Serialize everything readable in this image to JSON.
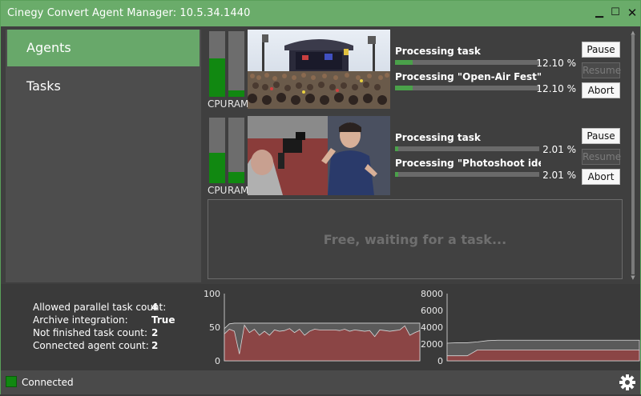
{
  "window": {
    "title": "Cinegy Convert Agent Manager: 10.5.34.1440",
    "controls": {
      "minimize": "▁",
      "maximize": "☐",
      "close": "✕"
    }
  },
  "sidebar": {
    "items": [
      {
        "label": "Agents",
        "active": true
      },
      {
        "label": "Tasks",
        "active": false
      }
    ]
  },
  "agents": [
    {
      "cpu_level": 0.58,
      "ram_level": 0.1,
      "cpu_label": "CPU",
      "ram_label": "RAM",
      "thumbnail": "concert-crowd",
      "tasks": [
        {
          "title": "Processing task",
          "percent_text": "12.10 %",
          "progress": 0.121
        },
        {
          "title": "Processing \"Open-Air Fest\" sour",
          "percent_text": "12.10 %",
          "progress": 0.121
        }
      ],
      "buttons": {
        "pause": "Pause",
        "resume": "Resume",
        "abort": "Abort"
      }
    },
    {
      "cpu_level": 0.46,
      "ram_level": 0.17,
      "cpu_label": "CPU",
      "ram_label": "RAM",
      "thumbnail": "camera-operator-interview",
      "tasks": [
        {
          "title": "Processing task",
          "percent_text": "2.01 %",
          "progress": 0.0201
        },
        {
          "title": "Processing \"Photoshoot ideas\" s",
          "percent_text": "2.01 %",
          "progress": 0.0201
        }
      ],
      "buttons": {
        "pause": "Pause",
        "resume": "Resume",
        "abort": "Abort"
      }
    }
  ],
  "free_slot": {
    "text": "Free, waiting for a task..."
  },
  "stats": [
    {
      "label": "Allowed parallel task count:",
      "value": "4"
    },
    {
      "label": "Archive integration:",
      "value": "True"
    },
    {
      "label": "Not finished task count:",
      "value": "2"
    },
    {
      "label": "Connected agent count:",
      "value": "2"
    }
  ],
  "status": {
    "text": "Connected",
    "color": "#118811"
  },
  "chart_data": [
    {
      "type": "area",
      "ylim": [
        0,
        100
      ],
      "yticks": [
        "100",
        "50",
        "0"
      ],
      "series": [
        {
          "values": [
            48,
            55,
            56,
            56,
            56,
            56,
            56,
            56,
            56,
            56,
            56,
            56,
            56,
            56,
            56,
            56,
            56,
            56,
            56,
            56,
            56,
            56,
            56,
            56,
            56,
            56,
            56,
            56,
            56,
            56,
            56,
            56,
            56,
            56,
            56,
            56,
            56,
            56,
            56,
            56
          ],
          "color": "#5a5a5a"
        },
        {
          "values": [
            40,
            47,
            44,
            10,
            53,
            42,
            47,
            38,
            44,
            38,
            46,
            44,
            45,
            48,
            42,
            47,
            38,
            44,
            47,
            46,
            46,
            46,
            46,
            45,
            47,
            44,
            46,
            45,
            44,
            45,
            36,
            46,
            45,
            44,
            45,
            46,
            52,
            38,
            42,
            45
          ],
          "color": "#8b4545"
        }
      ]
    },
    {
      "type": "area",
      "ylim": [
        0,
        8000
      ],
      "yticks": [
        "8000",
        "6000",
        "4000",
        "2000",
        "0"
      ],
      "series": [
        {
          "values": [
            2100,
            2150,
            2150,
            2250,
            2400,
            2450,
            2450,
            2450,
            2450,
            2450,
            2450,
            2450,
            2450,
            2450,
            2450,
            2450,
            2450,
            2450,
            2450,
            2450
          ],
          "color": "#5a5a5a"
        },
        {
          "values": [
            600,
            600,
            600,
            1300,
            1300,
            1300,
            1300,
            1300,
            1300,
            1300,
            1300,
            1300,
            1300,
            1300,
            1300,
            1300,
            1300,
            1300,
            1300,
            1300
          ],
          "color": "#8b4545"
        }
      ]
    }
  ]
}
